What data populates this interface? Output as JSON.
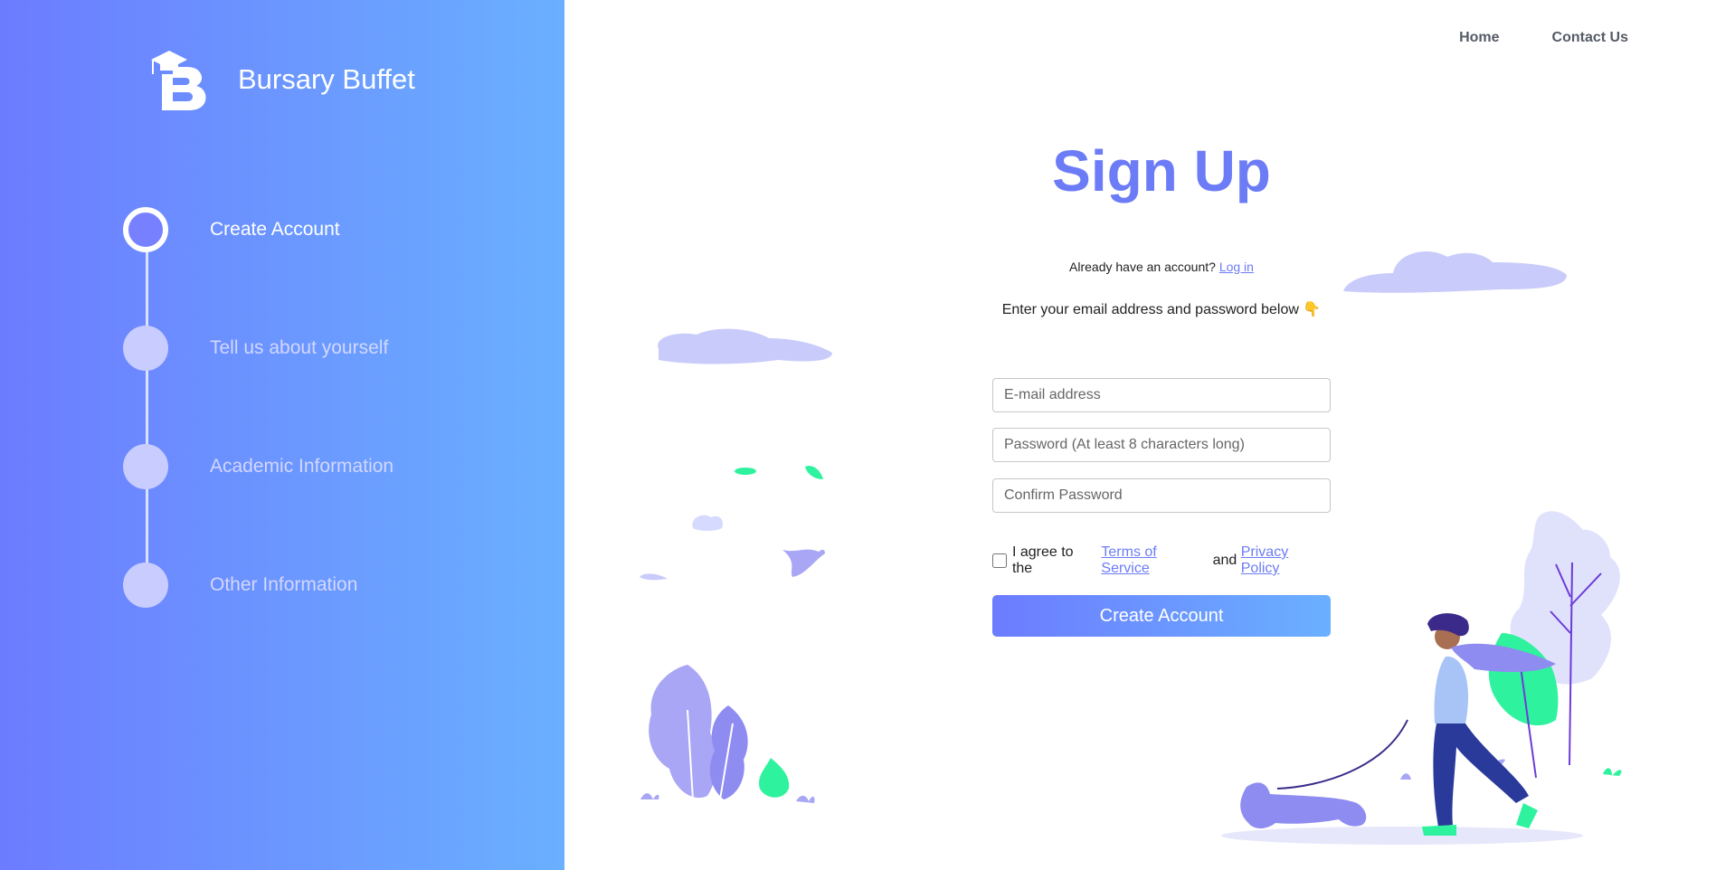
{
  "brand": {
    "name": "Bursary Buffet",
    "logo_icon": "graduation-cap-b-logo-icon"
  },
  "steps": [
    {
      "label": "Create Account",
      "active": true
    },
    {
      "label": "Tell us about yourself",
      "active": false
    },
    {
      "label": "Academic Information",
      "active": false
    },
    {
      "label": "Other Information",
      "active": false
    }
  ],
  "nav": {
    "home": "Home",
    "contact": "Contact Us"
  },
  "form": {
    "title": "Sign Up",
    "login_prompt": "Already have an account?",
    "login_link": "Log in",
    "instruction": "Enter your email address and password below 👇",
    "email_placeholder": "E-mail address",
    "password_placeholder": "Password (At least 8 characters long)",
    "confirm_placeholder": "Confirm Password",
    "agree_prefix": "I agree to the",
    "terms_link": "Terms of Service",
    "agree_and": "and",
    "privacy_link": "Privacy Policy",
    "submit_label": "Create Account"
  },
  "colors": {
    "accent": "#6c7cf6",
    "gradient_start": "#6c7cff",
    "gradient_end": "#6ab0ff",
    "illustration_lavender": "#c9ccfa",
    "illustration_green": "#2ff29e"
  }
}
